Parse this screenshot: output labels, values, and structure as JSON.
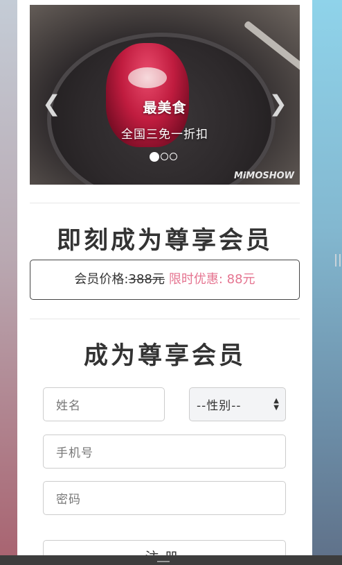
{
  "carousel": {
    "title": "最美食",
    "subtitle": "全国三免一折扣",
    "watermark": "MiMOSHOW",
    "prev_icon": "chevron-left-icon",
    "next_icon": "chevron-right-icon",
    "slide_count": 3,
    "active_slide": 1
  },
  "main": {
    "heading": "即刻成为尊享会员",
    "price": {
      "label": "会员价格:",
      "old_price": "388元",
      "promo": "限时优惠: 88元"
    },
    "form": {
      "heading": "成为尊享会员",
      "name_placeholder": "姓名",
      "gender_selected": "--性别--",
      "phone_placeholder": "手机号",
      "password_placeholder": "密码",
      "submit_label": "注册"
    }
  },
  "colors": {
    "promo": "#e57490",
    "heading": "#333333"
  }
}
